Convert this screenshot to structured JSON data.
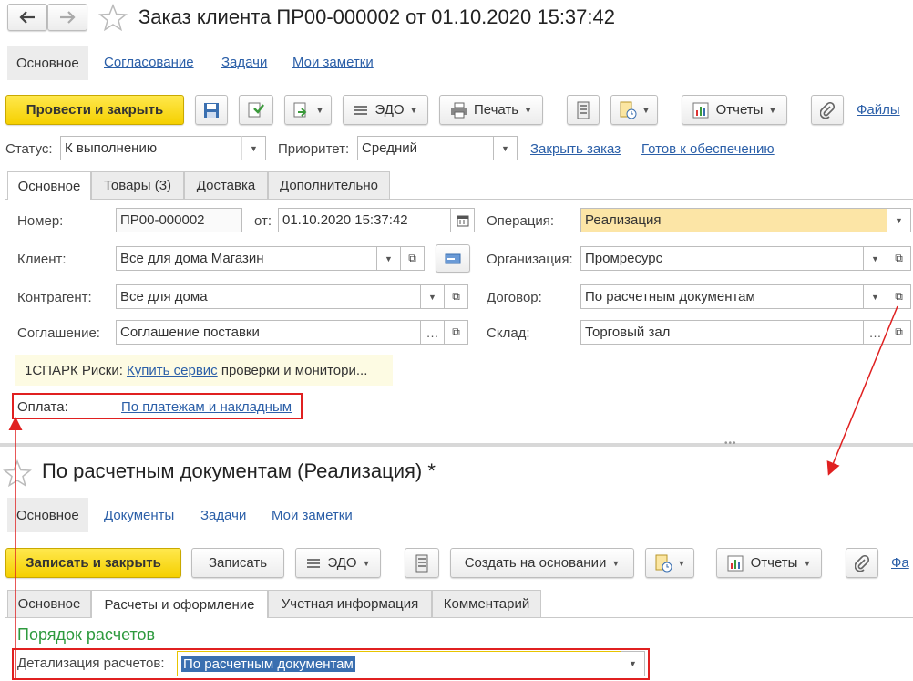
{
  "top": {
    "title": "Заказ клиента ПР00-000002 от 01.10.2020 15:37:42",
    "nav_tabs": [
      "Основное",
      "Согласование",
      "Задачи",
      "Мои заметки"
    ],
    "toolbar": {
      "post_close": "Провести и закрыть",
      "edo": "ЭДО",
      "print": "Печать",
      "reports": "Отчеты",
      "files": "Файлы"
    },
    "status_label": "Статус:",
    "status_value": "К выполнению",
    "priority_label": "Приоритет:",
    "priority_value": "Средний",
    "close_order": "Закрыть заказ",
    "ready": "Готов к обеспечению",
    "tabs": [
      "Основное",
      "Товары (3)",
      "Доставка",
      "Дополнительно"
    ],
    "fields": {
      "number_label": "Номер:",
      "number_value": "ПР00-000002",
      "from_label": "от:",
      "date_value": "01.10.2020 15:37:42",
      "operation_label": "Операция:",
      "operation_value": "Реализация",
      "client_label": "Клиент:",
      "client_value": "Все для дома Магазин",
      "org_label": "Организация:",
      "org_value": "Промресурс",
      "counterparty_label": "Контрагент:",
      "counterparty_value": "Все для дома",
      "contract_label": "Договор:",
      "contract_value": "По расчетным документам",
      "agreement_label": "Соглашение:",
      "agreement_value": "Соглашение поставки",
      "warehouse_label": "Склад:",
      "warehouse_value": "Торговый зал"
    },
    "spark_prefix": "1СПАРК Риски:",
    "spark_link": "Купить сервис",
    "spark_suffix": "проверки и монитори...",
    "payment_label": "Оплата:",
    "payment_link": "По платежам и накладным"
  },
  "bottom": {
    "title": "По расчетным документам (Реализация) *",
    "nav_tabs": [
      "Основное",
      "Документы",
      "Задачи",
      "Мои заметки"
    ],
    "toolbar": {
      "save_close": "Записать и закрыть",
      "save": "Записать",
      "edo": "ЭДО",
      "create_based": "Создать на основании",
      "reports": "Отчеты",
      "files": "Фа"
    },
    "tabs": [
      "Основное",
      "Расчеты и оформление",
      "Учетная информация",
      "Комментарий"
    ],
    "section_title": "Порядок расчетов",
    "detail_label": "Детализация расчетов:",
    "detail_value": "По расчетным документам"
  },
  "colors": {
    "accent_red": "#e02020",
    "link": "#2b5fa8",
    "section_green": "#2e9a3e",
    "yellow": "#f5d000"
  }
}
